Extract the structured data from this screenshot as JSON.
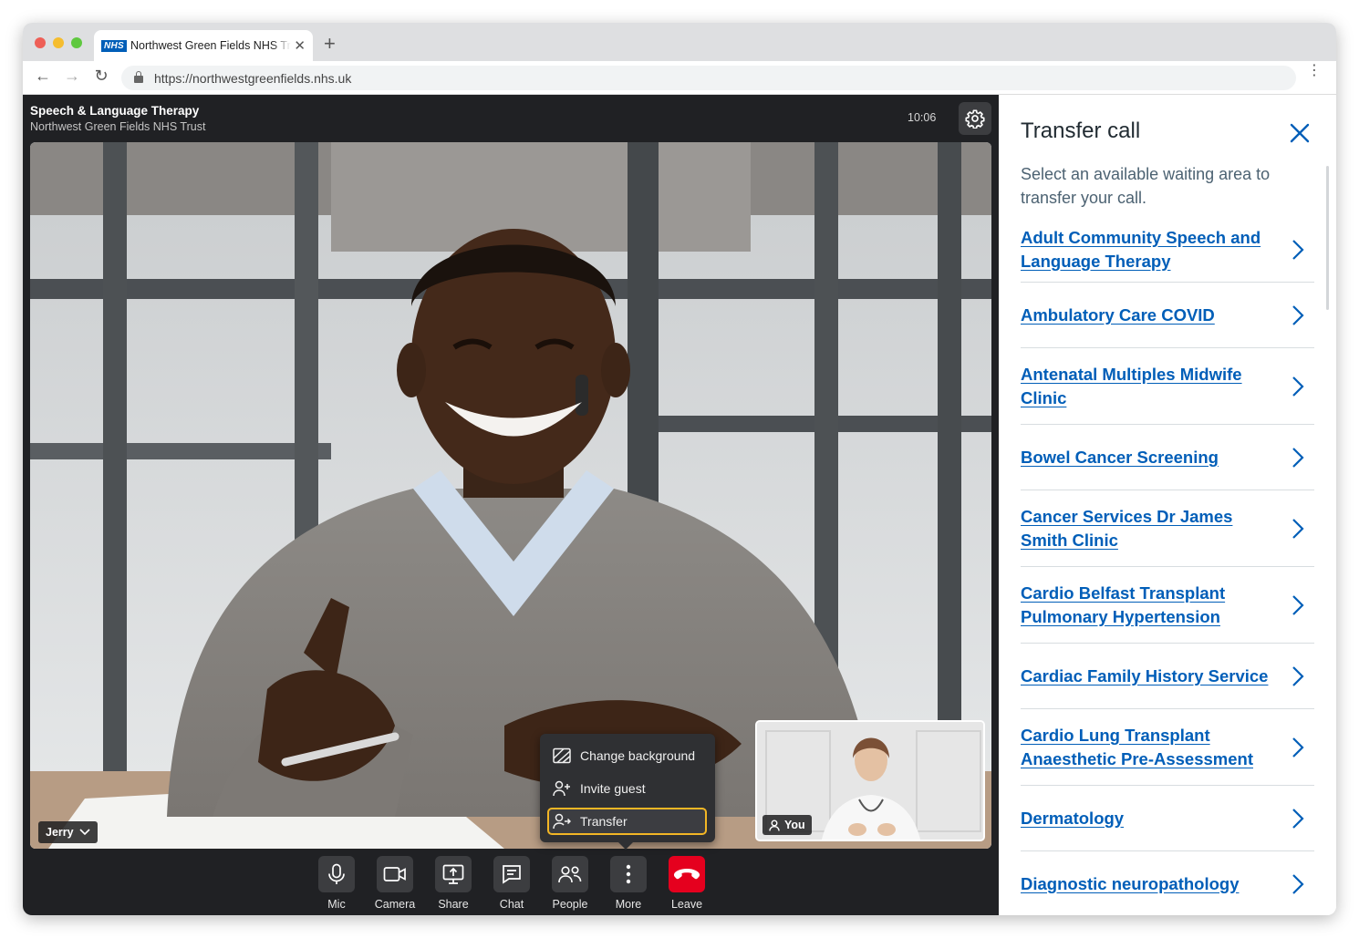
{
  "browser": {
    "tab_title": "Northwest Green Fields NHS Trust",
    "tab_badge": "NHS",
    "new_tab_symbol": "+",
    "close_symbol": "✕",
    "url": "https://northwestgreenfields.nhs.uk",
    "nav": {
      "back": "←",
      "forward": "→",
      "reload": "↻",
      "menu": "⋮"
    }
  },
  "call": {
    "clinic_name": "Speech & Language Therapy",
    "organisation": "Northwest Green Fields NHS Trust",
    "time": "10:06",
    "participant_name": "Jerry",
    "self_label": "You"
  },
  "more_menu": {
    "items": [
      "Change background",
      "Invite guest",
      "Transfer"
    ],
    "highlighted": "Transfer",
    "highlight_color": "#f2b625"
  },
  "controls": [
    {
      "label": "Mic",
      "icon": "mic-icon"
    },
    {
      "label": "Camera",
      "icon": "camera-icon"
    },
    {
      "label": "Share",
      "icon": "share-screen-icon"
    },
    {
      "label": "Chat",
      "icon": "chat-icon"
    },
    {
      "label": "People",
      "icon": "people-icon"
    },
    {
      "label": "More",
      "icon": "more-icon"
    },
    {
      "label": "Leave",
      "icon": "hangup-icon"
    }
  ],
  "panel": {
    "title": "Transfer call",
    "intro": "Select an available waiting area to transfer your call.",
    "link_color": "#005eb8",
    "areas": [
      "Adult Community Speech and Language Therapy",
      "Ambulatory Care COVID",
      "Antenatal Multiples Midwife Clinic",
      "Bowel Cancer Screening",
      "Cancer Services Dr James Smith Clinic",
      "Cardio Belfast Transplant Pulmonary Hypertension",
      "Cardiac Family History Service",
      "Cardio Lung Transplant Anaesthetic Pre-Assessment",
      "Dermatology",
      "Diagnostic neuropathology"
    ]
  },
  "colors": {
    "leave": "#e5001e",
    "call_bg": "#202124",
    "nhs_blue": "#005eb8"
  }
}
